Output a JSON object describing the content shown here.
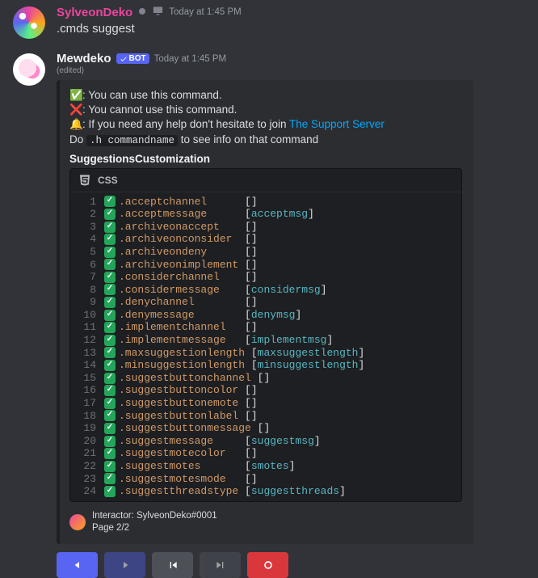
{
  "msg1": {
    "author": "SylveonDeko",
    "timestamp": "Today at 1:45 PM",
    "content": ".cmds suggest"
  },
  "msg2": {
    "author": "Mewdeko",
    "bot_tag": "BOT",
    "timestamp": "Today at 1:45 PM",
    "edited": "(edited)"
  },
  "embed": {
    "desc_line1_emoji": "✅",
    "desc_line1": ": You can use this command.",
    "desc_line2_emoji": "❌",
    "desc_line2": ": You cannot use this command.",
    "desc_line3_emoji": "🔔",
    "desc_line3a": ": If you need any help don't hesitate to join ",
    "desc_line3_link": "The Support Server",
    "desc_line4a": "Do ",
    "desc_line4_code": ".h commandname",
    "desc_line4b": " to see info on that command",
    "field_title": "SuggestionsCustomization",
    "code_lang": "CSS",
    "rows": [
      {
        "n": "1",
        "cmd": ".acceptchannel",
        "alias": ""
      },
      {
        "n": "2",
        "cmd": ".acceptmessage",
        "alias": "acceptmsg"
      },
      {
        "n": "3",
        "cmd": ".archiveonaccept",
        "alias": ""
      },
      {
        "n": "4",
        "cmd": ".archiveonconsider",
        "alias": ""
      },
      {
        "n": "5",
        "cmd": ".archiveondeny",
        "alias": ""
      },
      {
        "n": "6",
        "cmd": ".archiveonimplement",
        "alias": ""
      },
      {
        "n": "7",
        "cmd": ".considerchannel",
        "alias": ""
      },
      {
        "n": "8",
        "cmd": ".considermessage",
        "alias": "considermsg"
      },
      {
        "n": "9",
        "cmd": ".denychannel",
        "alias": ""
      },
      {
        "n": "10",
        "cmd": ".denymessage",
        "alias": "denymsg"
      },
      {
        "n": "11",
        "cmd": ".implementchannel",
        "alias": ""
      },
      {
        "n": "12",
        "cmd": ".implementmessage",
        "alias": "implementmsg"
      },
      {
        "n": "13",
        "cmd": ".maxsuggestionlength",
        "alias": "maxsuggestlength"
      },
      {
        "n": "14",
        "cmd": ".minsuggestionlength",
        "alias": "minsuggestlength"
      },
      {
        "n": "15",
        "cmd": ".suggestbuttonchannel",
        "alias": ""
      },
      {
        "n": "16",
        "cmd": ".suggestbuttoncolor",
        "alias": ""
      },
      {
        "n": "17",
        "cmd": ".suggestbuttonemote",
        "alias": ""
      },
      {
        "n": "18",
        "cmd": ".suggestbuttonlabel",
        "alias": ""
      },
      {
        "n": "19",
        "cmd": ".suggestbuttonmessage",
        "alias": ""
      },
      {
        "n": "20",
        "cmd": ".suggestmessage",
        "alias": "suggestmsg"
      },
      {
        "n": "21",
        "cmd": ".suggestmotecolor",
        "alias": ""
      },
      {
        "n": "22",
        "cmd": ".suggestmotes",
        "alias": "smotes"
      },
      {
        "n": "23",
        "cmd": ".suggestmotesmode",
        "alias": ""
      },
      {
        "n": "24",
        "cmd": ".suggestthreadstype",
        "alias": "suggestthreads"
      }
    ],
    "cmd_col_width": 20,
    "footer_line1": "Interactor: SylveonDeko#0001",
    "footer_line2": "Page 2/2"
  },
  "buttons": {
    "prev": "◀",
    "play": "▶",
    "first": "⏮",
    "last": "⏭",
    "stop": "●"
  }
}
